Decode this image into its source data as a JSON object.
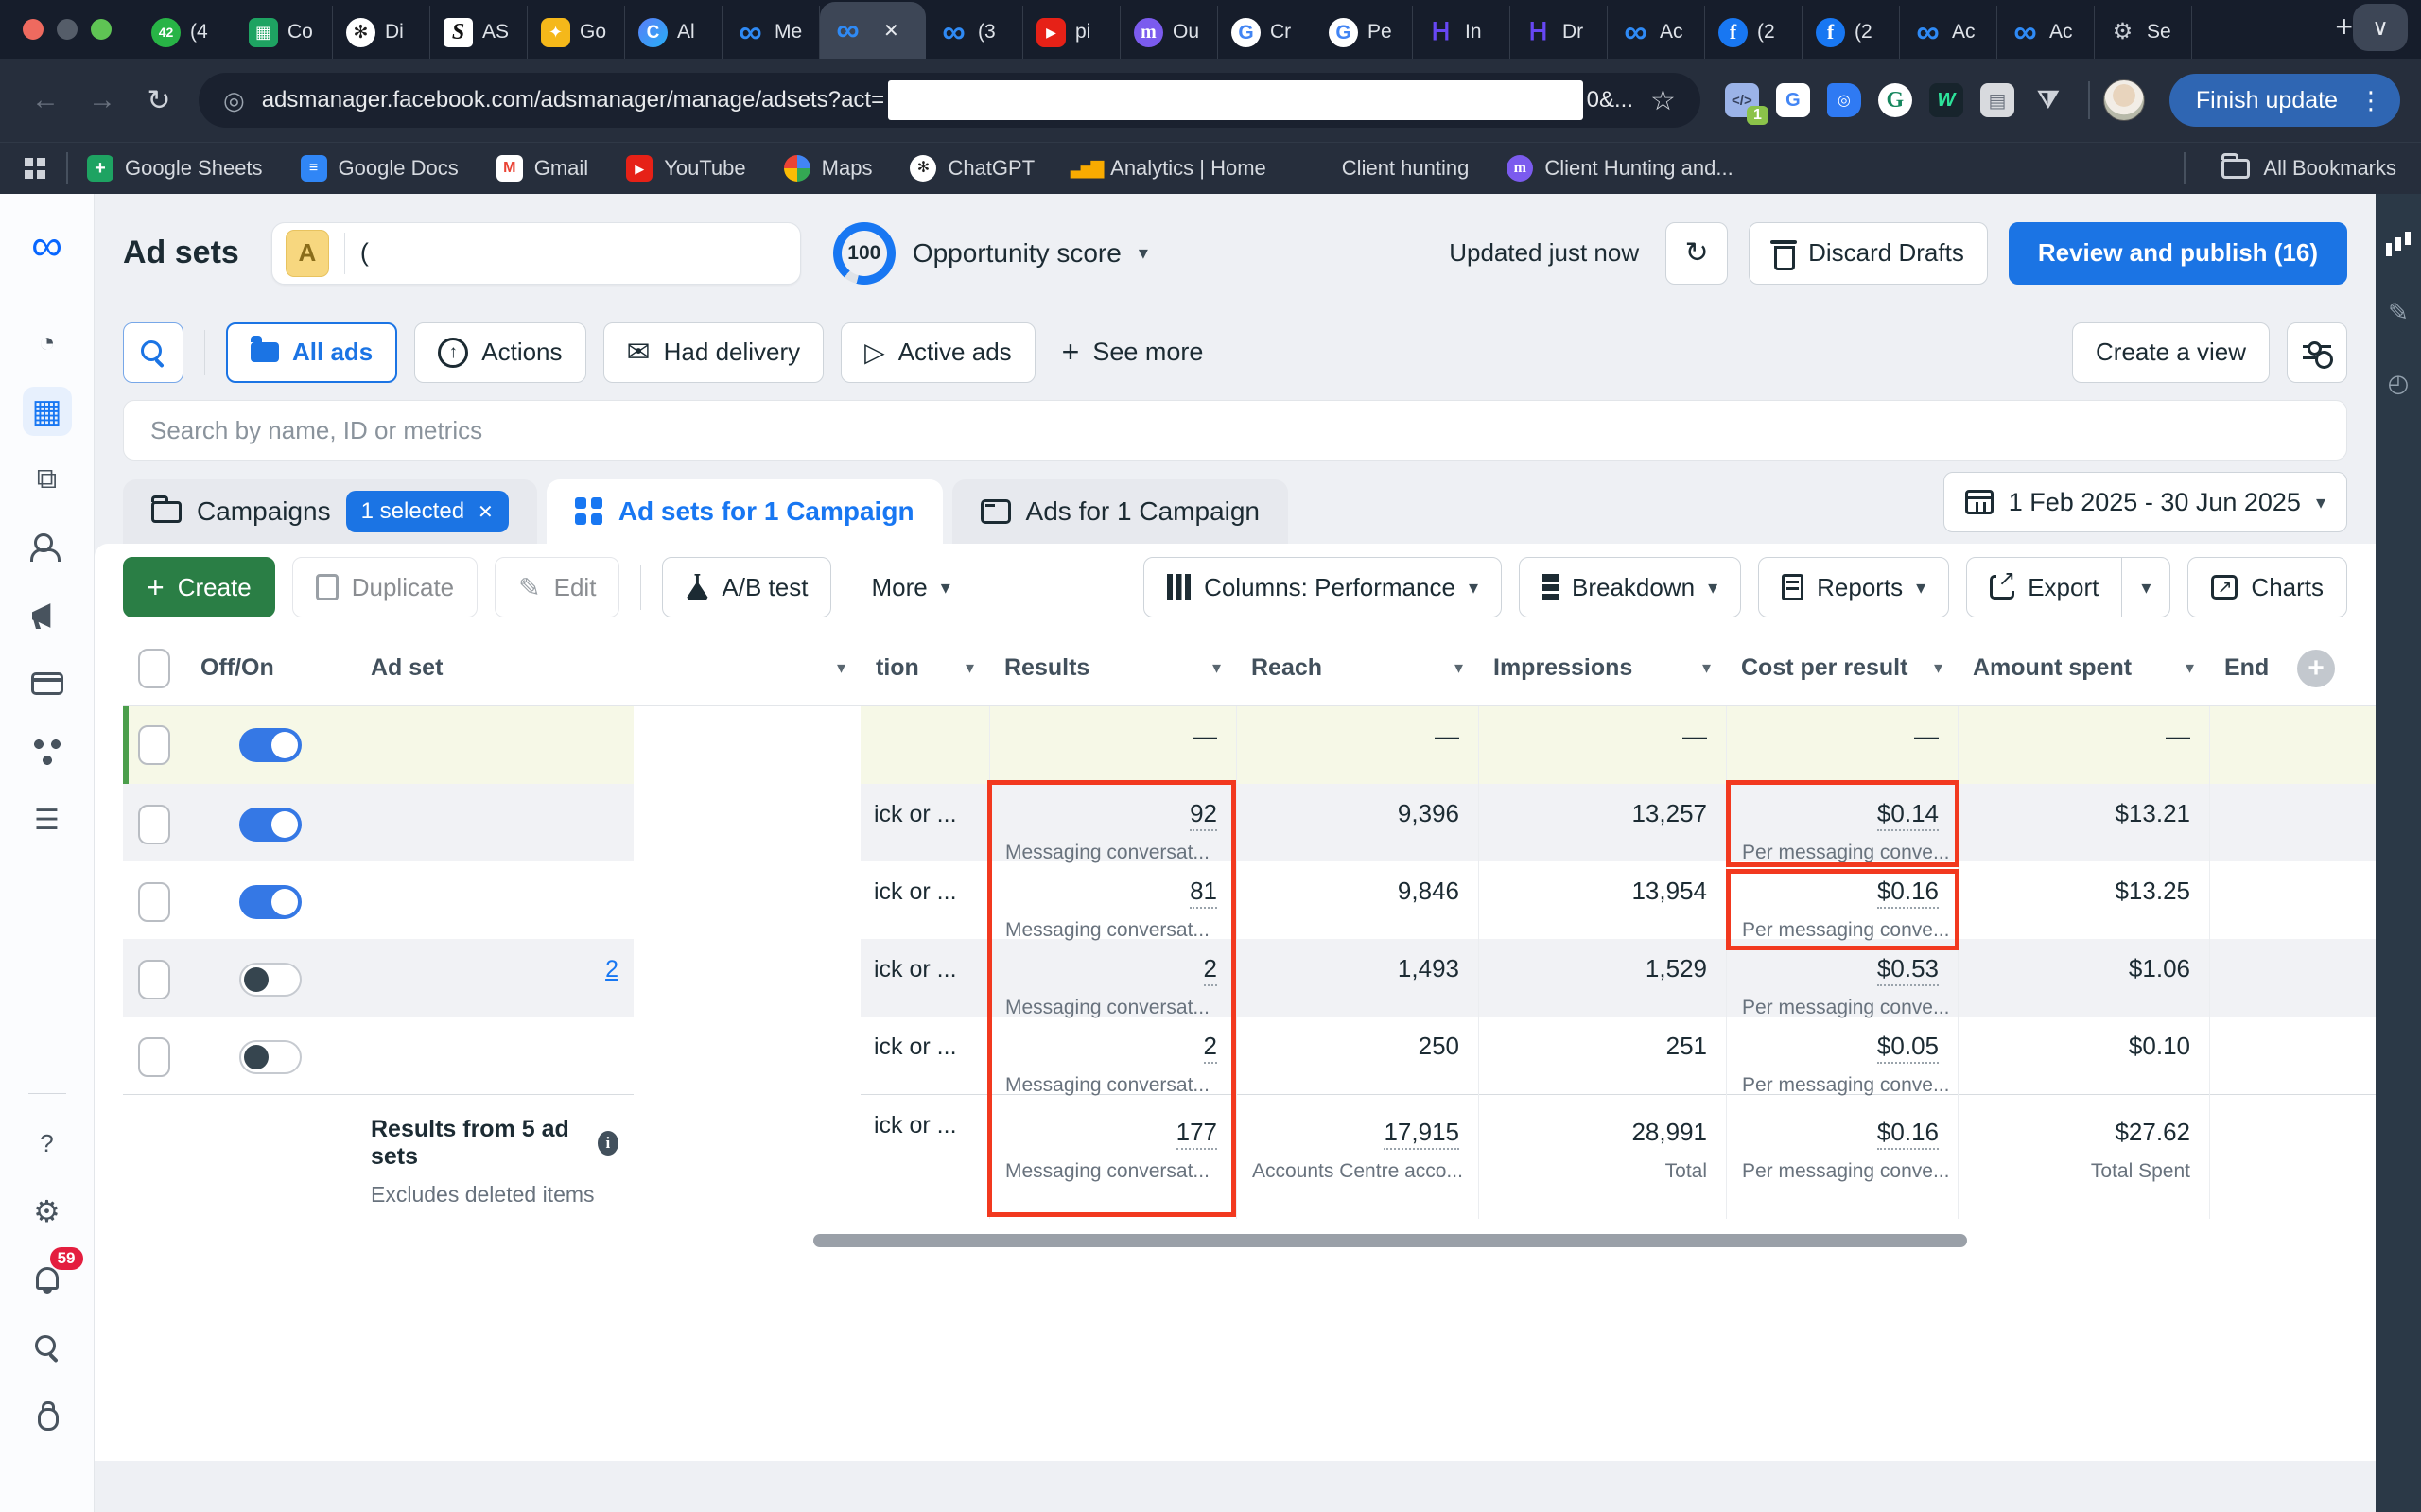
{
  "colors": {
    "accent_blue": "#1b74e4",
    "meta_blue": "#0866ff",
    "toggle_blue": "#3578e5",
    "create_green": "#2a7e45",
    "annotation_red": "#f2391f",
    "selected_row_bg": "#f6f8e7",
    "selected_row_bar": "#4b9e4b",
    "chrome_dark": "#161d2b",
    "finish_update_blue": "#2f66b3",
    "notification_red": "#e41e3f"
  },
  "browser": {
    "tabs": [
      {
        "icon": "whatsapp",
        "label": "(4",
        "cls": ""
      },
      {
        "icon": "sheets",
        "label": "Co",
        "cls": ""
      },
      {
        "icon": "chatgpt",
        "label": "Di",
        "cls": ""
      },
      {
        "icon": "scripts",
        "label": "AS",
        "cls": ""
      },
      {
        "icon": "keep",
        "label": "Go",
        "cls": ""
      },
      {
        "icon": "circlec",
        "label": "Al",
        "cls": ""
      },
      {
        "icon": "meta",
        "label": "Me",
        "cls": ""
      },
      {
        "icon": "meta",
        "label": "",
        "cls": "active"
      },
      {
        "icon": "meta",
        "label": "(3",
        "cls": ""
      },
      {
        "icon": "youtube",
        "label": "pi",
        "cls": ""
      },
      {
        "icon": "mediumm",
        "label": "Ou",
        "cls": ""
      },
      {
        "icon": "google",
        "label": "Cr",
        "cls": ""
      },
      {
        "icon": "google",
        "label": "Pe",
        "cls": ""
      },
      {
        "icon": "hostinger",
        "label": "In",
        "cls": ""
      },
      {
        "icon": "hostinger",
        "label": "Dr",
        "cls": ""
      },
      {
        "icon": "meta",
        "label": "Ac",
        "cls": ""
      },
      {
        "icon": "facebook",
        "label": "(2",
        "cls": ""
      },
      {
        "icon": "facebook",
        "label": "(2",
        "cls": ""
      },
      {
        "icon": "meta",
        "label": "Ac",
        "cls": ""
      },
      {
        "icon": "meta",
        "label": "Ac",
        "cls": ""
      },
      {
        "icon": "gearfav",
        "label": "Se",
        "cls": ""
      }
    ],
    "url": "adsmanager.facebook.com/adsmanager/manage/adsets?act=",
    "url_suffix": "0&...",
    "extension_badge": "1",
    "finish_update": "Finish update",
    "bookmarks": [
      {
        "icon": "sheetsbm",
        "label": "Google Sheets"
      },
      {
        "icon": "docsbm",
        "label": "Google Docs"
      },
      {
        "icon": "gmailbm",
        "label": "Gmail"
      },
      {
        "icon": "ytbm",
        "label": "YouTube"
      },
      {
        "icon": "mapsbm",
        "label": "Maps"
      },
      {
        "icon": "gptbm",
        "label": "ChatGPT"
      },
      {
        "icon": "anbm",
        "label": "Analytics | Home"
      },
      {
        "icon": "folderbm",
        "label": "Client hunting"
      },
      {
        "icon": "mediumm",
        "label": "Client Hunting and..."
      }
    ],
    "all_bookmarks": "All Bookmarks"
  },
  "sidebar": {
    "icons": [
      "meta-logo",
      "account-overview-gauge",
      "campaigns-table-grid",
      "ads-reporting-pages",
      "audiences-people",
      "advertise-megaphone",
      "billing-card",
      "events-nodes",
      "all-tools-menu"
    ],
    "bottom_icons": [
      "help",
      "settings-gear",
      "notifications-bell",
      "search",
      "report-bug"
    ],
    "notification_count": "59"
  },
  "right_rail": {
    "icons": [
      "bar-chart",
      "edit-pencil",
      "history-clock"
    ]
  },
  "header": {
    "title": "Ad sets",
    "search_badge": "A",
    "search_query": "(",
    "score_value": "100",
    "score_label": "Opportunity score",
    "updated": "Updated just now",
    "discard_drafts": "Discard Drafts",
    "review_publish": "Review and publish (16)"
  },
  "filters": {
    "all_ads": "All ads",
    "actions": "Actions",
    "had_delivery": "Had delivery",
    "active_ads": "Active ads",
    "see_more": "See more",
    "create_view": "Create a view"
  },
  "search": {
    "placeholder": "Search by name, ID or metrics"
  },
  "level_tabs": {
    "campaigns": "Campaigns",
    "selected_badge": "1 selected",
    "adsets": "Ad sets for 1 Campaign",
    "ads": "Ads for 1 Campaign",
    "date_range": "1 Feb 2025 - 30 Jun 2025"
  },
  "toolbar": {
    "create": "Create",
    "duplicate": "Duplicate",
    "edit": "Edit",
    "ab_test": "A/B test",
    "more": "More",
    "columns": "Columns: Performance",
    "breakdown": "Breakdown",
    "reports": "Reports",
    "export": "Export",
    "charts": "Charts"
  },
  "table": {
    "columns": {
      "off_on": "Off/On",
      "ad_set": "Ad set",
      "attribution_partial": "tion",
      "results": "Results",
      "reach": "Reach",
      "impressions": "Impressions",
      "cost_per_result": "Cost per result",
      "amount_spent": "Amount spent",
      "end": "End"
    },
    "rows": [
      {
        "state": "on",
        "attribution": "",
        "results": "—",
        "reach": "—",
        "impressions": "—",
        "cost": "—",
        "amount": "—"
      },
      {
        "state": "on",
        "attribution": "ick or ...",
        "results": "92",
        "results_sub": "Messaging conversat...",
        "reach": "9,396",
        "impressions": "13,257",
        "cost": "$0.14",
        "cost_sub": "Per messaging conve...",
        "amount": "$13.21"
      },
      {
        "state": "on",
        "attribution": "ick or ...",
        "results": "81",
        "results_sub": "Messaging conversat...",
        "reach": "9,846",
        "impressions": "13,954",
        "cost": "$0.16",
        "cost_sub": "Per messaging conve...",
        "amount": "$13.25"
      },
      {
        "state": "off",
        "attribution": "ick or ...",
        "name_fragment": "2",
        "results": "2",
        "results_sub": "Messaging conversat...",
        "reach": "1,493",
        "impressions": "1,529",
        "cost": "$0.53",
        "cost_sub": "Per messaging conve...",
        "amount": "$1.06"
      },
      {
        "state": "off",
        "attribution": "ick or ...",
        "results": "2",
        "results_sub": "Messaging conversat...",
        "reach": "250",
        "impressions": "251",
        "cost": "$0.05",
        "cost_sub": "Per messaging conve...",
        "amount": "$0.10"
      }
    ],
    "summary": {
      "title": "Results from 5 ad sets",
      "note": "Excludes deleted items",
      "attribution": "ick or ...",
      "results": "177",
      "results_sub": "Messaging conversat...",
      "reach": "17,915",
      "reach_sub": "Accounts Centre acco...",
      "impressions": "28,991",
      "impressions_sub": "Total",
      "cost": "$0.16",
      "cost_sub": "Per messaging conve...",
      "amount": "$27.62",
      "amount_sub": "Total Spent"
    }
  }
}
